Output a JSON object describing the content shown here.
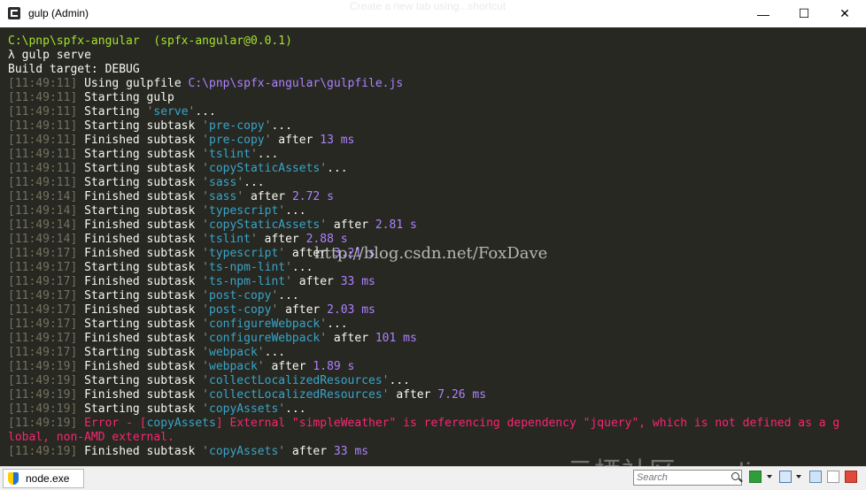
{
  "window": {
    "title": "gulp (Admin)",
    "ghost_text": "Create a new tab using...shortcut",
    "controls": {
      "minimize": "—",
      "maximize": "☐",
      "close": "✕"
    }
  },
  "terminal": {
    "prompt_path": "C:\\pnp\\spfx-angular",
    "prompt_pkg": "(spfx-angular@0.0.1)",
    "command": "λ gulp serve",
    "build_target": "Build target: DEBUG",
    "lines": [
      {
        "ts": "[11:49:11]",
        "parts": [
          {
            "t": "Using gulpfile ",
            "c": ""
          },
          {
            "t": "C:\\pnp\\spfx-angular\\gulpfile.js",
            "c": "purple"
          }
        ]
      },
      {
        "ts": "[11:49:11]",
        "parts": [
          {
            "t": "Starting gulp",
            "c": ""
          }
        ]
      },
      {
        "ts": "[11:49:11]",
        "parts": [
          {
            "t": "Starting ",
            "c": ""
          },
          {
            "t": "'",
            "c": "q"
          },
          {
            "t": "serve",
            "c": "cyan"
          },
          {
            "t": "'",
            "c": "q"
          },
          {
            "t": "...",
            "c": ""
          }
        ]
      },
      {
        "ts": "[11:49:11]",
        "parts": [
          {
            "t": "Starting subtask ",
            "c": ""
          },
          {
            "t": "'",
            "c": "q"
          },
          {
            "t": "pre-copy",
            "c": "cyan"
          },
          {
            "t": "'",
            "c": "q"
          },
          {
            "t": "...",
            "c": ""
          }
        ]
      },
      {
        "ts": "[11:49:11]",
        "parts": [
          {
            "t": "Finished subtask ",
            "c": ""
          },
          {
            "t": "'",
            "c": "q"
          },
          {
            "t": "pre-copy",
            "c": "cyan"
          },
          {
            "t": "'",
            "c": "q"
          },
          {
            "t": " after ",
            "c": ""
          },
          {
            "t": "13 ms",
            "c": "purple"
          }
        ]
      },
      {
        "ts": "[11:49:11]",
        "parts": [
          {
            "t": "Starting subtask ",
            "c": ""
          },
          {
            "t": "'",
            "c": "q"
          },
          {
            "t": "tslint",
            "c": "cyan"
          },
          {
            "t": "'",
            "c": "q"
          },
          {
            "t": "...",
            "c": ""
          }
        ]
      },
      {
        "ts": "[11:49:11]",
        "parts": [
          {
            "t": "Starting subtask ",
            "c": ""
          },
          {
            "t": "'",
            "c": "q"
          },
          {
            "t": "copyStaticAssets",
            "c": "cyan"
          },
          {
            "t": "'",
            "c": "q"
          },
          {
            "t": "...",
            "c": ""
          }
        ]
      },
      {
        "ts": "[11:49:11]",
        "parts": [
          {
            "t": "Starting subtask ",
            "c": ""
          },
          {
            "t": "'",
            "c": "q"
          },
          {
            "t": "sass",
            "c": "cyan"
          },
          {
            "t": "'",
            "c": "q"
          },
          {
            "t": "...",
            "c": ""
          }
        ]
      },
      {
        "ts": "[11:49:14]",
        "parts": [
          {
            "t": "Finished subtask ",
            "c": ""
          },
          {
            "t": "'",
            "c": "q"
          },
          {
            "t": "sass",
            "c": "cyan"
          },
          {
            "t": "'",
            "c": "q"
          },
          {
            "t": " after ",
            "c": ""
          },
          {
            "t": "2.72 s",
            "c": "purple"
          }
        ]
      },
      {
        "ts": "[11:49:14]",
        "parts": [
          {
            "t": "Starting subtask ",
            "c": ""
          },
          {
            "t": "'",
            "c": "q"
          },
          {
            "t": "typescript",
            "c": "cyan"
          },
          {
            "t": "'",
            "c": "q"
          },
          {
            "t": "...",
            "c": ""
          }
        ]
      },
      {
        "ts": "[11:49:14]",
        "parts": [
          {
            "t": "Finished subtask ",
            "c": ""
          },
          {
            "t": "'",
            "c": "q"
          },
          {
            "t": "copyStaticAssets",
            "c": "cyan"
          },
          {
            "t": "'",
            "c": "q"
          },
          {
            "t": " after ",
            "c": ""
          },
          {
            "t": "2.81 s",
            "c": "purple"
          }
        ]
      },
      {
        "ts": "[11:49:14]",
        "parts": [
          {
            "t": "Finished subtask ",
            "c": ""
          },
          {
            "t": "'",
            "c": "q"
          },
          {
            "t": "tslint",
            "c": "cyan"
          },
          {
            "t": "'",
            "c": "q"
          },
          {
            "t": " after ",
            "c": ""
          },
          {
            "t": "2.88 s",
            "c": "purple"
          }
        ]
      },
      {
        "ts": "[11:49:17]",
        "parts": [
          {
            "t": "Finished subtask ",
            "c": ""
          },
          {
            "t": "'",
            "c": "q"
          },
          {
            "t": "typescript",
            "c": "cyan"
          },
          {
            "t": "'",
            "c": "q"
          },
          {
            "t": " after ",
            "c": ""
          },
          {
            "t": "3.21 s",
            "c": "purple"
          }
        ]
      },
      {
        "ts": "[11:49:17]",
        "parts": [
          {
            "t": "Starting subtask ",
            "c": ""
          },
          {
            "t": "'",
            "c": "q"
          },
          {
            "t": "ts-npm-lint",
            "c": "cyan"
          },
          {
            "t": "'",
            "c": "q"
          },
          {
            "t": "...",
            "c": ""
          }
        ]
      },
      {
        "ts": "[11:49:17]",
        "parts": [
          {
            "t": "Finished subtask ",
            "c": ""
          },
          {
            "t": "'",
            "c": "q"
          },
          {
            "t": "ts-npm-lint",
            "c": "cyan"
          },
          {
            "t": "'",
            "c": "q"
          },
          {
            "t": " after ",
            "c": ""
          },
          {
            "t": "33 ms",
            "c": "purple"
          }
        ]
      },
      {
        "ts": "[11:49:17]",
        "parts": [
          {
            "t": "Starting subtask ",
            "c": ""
          },
          {
            "t": "'",
            "c": "q"
          },
          {
            "t": "post-copy",
            "c": "cyan"
          },
          {
            "t": "'",
            "c": "q"
          },
          {
            "t": "...",
            "c": ""
          }
        ]
      },
      {
        "ts": "[11:49:17]",
        "parts": [
          {
            "t": "Finished subtask ",
            "c": ""
          },
          {
            "t": "'",
            "c": "q"
          },
          {
            "t": "post-copy",
            "c": "cyan"
          },
          {
            "t": "'",
            "c": "q"
          },
          {
            "t": " after ",
            "c": ""
          },
          {
            "t": "2.03 ms",
            "c": "purple"
          }
        ]
      },
      {
        "ts": "[11:49:17]",
        "parts": [
          {
            "t": "Starting subtask ",
            "c": ""
          },
          {
            "t": "'",
            "c": "q"
          },
          {
            "t": "configureWebpack",
            "c": "cyan"
          },
          {
            "t": "'",
            "c": "q"
          },
          {
            "t": "...",
            "c": ""
          }
        ]
      },
      {
        "ts": "[11:49:17]",
        "parts": [
          {
            "t": "Finished subtask ",
            "c": ""
          },
          {
            "t": "'",
            "c": "q"
          },
          {
            "t": "configureWebpack",
            "c": "cyan"
          },
          {
            "t": "'",
            "c": "q"
          },
          {
            "t": " after ",
            "c": ""
          },
          {
            "t": "101 ms",
            "c": "purple"
          }
        ]
      },
      {
        "ts": "[11:49:17]",
        "parts": [
          {
            "t": "Starting subtask ",
            "c": ""
          },
          {
            "t": "'",
            "c": "q"
          },
          {
            "t": "webpack",
            "c": "cyan"
          },
          {
            "t": "'",
            "c": "q"
          },
          {
            "t": "...",
            "c": ""
          }
        ]
      },
      {
        "ts": "[11:49:19]",
        "parts": [
          {
            "t": "Finished subtask ",
            "c": ""
          },
          {
            "t": "'",
            "c": "q"
          },
          {
            "t": "webpack",
            "c": "cyan"
          },
          {
            "t": "'",
            "c": "q"
          },
          {
            "t": " after ",
            "c": ""
          },
          {
            "t": "1.89 s",
            "c": "purple"
          }
        ]
      },
      {
        "ts": "[11:49:19]",
        "parts": [
          {
            "t": "Starting subtask ",
            "c": ""
          },
          {
            "t": "'",
            "c": "q"
          },
          {
            "t": "collectLocalizedResources",
            "c": "cyan"
          },
          {
            "t": "'",
            "c": "q"
          },
          {
            "t": "...",
            "c": ""
          }
        ]
      },
      {
        "ts": "[11:49:19]",
        "parts": [
          {
            "t": "Finished subtask ",
            "c": ""
          },
          {
            "t": "'",
            "c": "q"
          },
          {
            "t": "collectLocalizedResources",
            "c": "cyan"
          },
          {
            "t": "'",
            "c": "q"
          },
          {
            "t": " after ",
            "c": ""
          },
          {
            "t": "7.26 ms",
            "c": "purple"
          }
        ]
      },
      {
        "ts": "[11:49:19]",
        "parts": [
          {
            "t": "Starting subtask ",
            "c": ""
          },
          {
            "t": "'",
            "c": "q"
          },
          {
            "t": "copyAssets",
            "c": "cyan"
          },
          {
            "t": "'",
            "c": "q"
          },
          {
            "t": "...",
            "c": ""
          }
        ]
      },
      {
        "ts": "[11:49:19]",
        "parts": [
          {
            "t": "Error - [",
            "c": "red"
          },
          {
            "t": "copyAssets",
            "c": "cyan"
          },
          {
            "t": "] External \"simpleWeather\" is referencing dependency \"jquery\", which is not defined as a g",
            "c": "red"
          }
        ]
      },
      {
        "ts": "",
        "parts": [
          {
            "t": "lobal, non-AMD external.",
            "c": "red"
          }
        ]
      },
      {
        "ts": "[11:49:19]",
        "parts": [
          {
            "t": "Finished subtask ",
            "c": ""
          },
          {
            "t": "'",
            "c": "q"
          },
          {
            "t": "copyAssets",
            "c": "cyan"
          },
          {
            "t": "'",
            "c": "q"
          },
          {
            "t": " after ",
            "c": ""
          },
          {
            "t": "33 ms",
            "c": "purple"
          }
        ]
      }
    ],
    "watermark": "http://blog.csdn.net/FoxDave",
    "corner_watermark": "云栖社区 yq.aliyun.com"
  },
  "statusbar": {
    "tab_label": "node.exe",
    "search_placeholder": "Search"
  },
  "colors": {
    "terminal_bg": "#272822",
    "text": "#f8f8f2",
    "timestamp": "#75715e",
    "cyan": "#39a4c9",
    "purple": "#ae81ff",
    "green": "#a6e22e",
    "red": "#f92672"
  }
}
